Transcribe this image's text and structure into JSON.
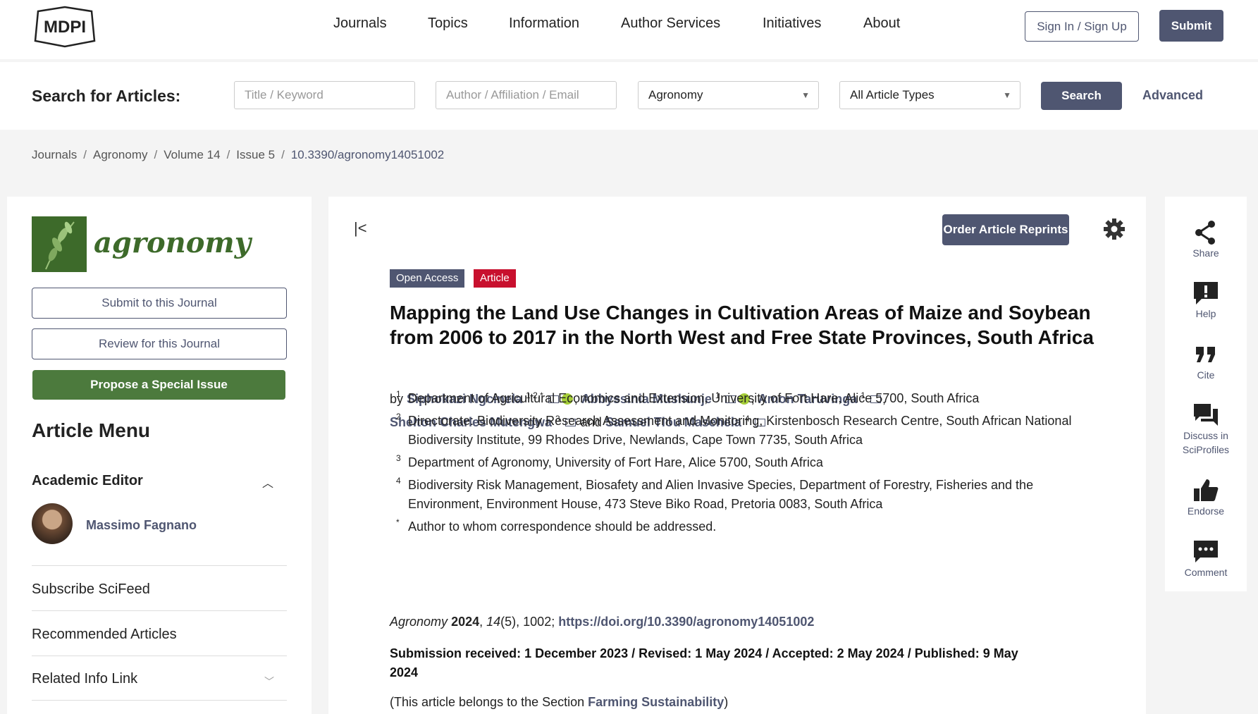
{
  "header": {
    "logo_text": "MDPI",
    "nav": [
      "Journals",
      "Topics",
      "Information",
      "Author Services",
      "Initiatives",
      "About"
    ],
    "signin_label": "Sign In / Sign Up",
    "submit_label": "Submit"
  },
  "search": {
    "label": "Search for Articles:",
    "title_placeholder": "Title / Keyword",
    "author_placeholder": "Author / Affiliation / Email",
    "journal_selected": "Agronomy",
    "type_selected": "All Article Types",
    "search_button": "Search",
    "advanced_label": "Advanced"
  },
  "breadcrumb": [
    "Journals",
    "Agronomy",
    "Volume 14",
    "Issue 5",
    "10.3390/agronomy14051002"
  ],
  "sidebar": {
    "journal_name": "agronomy",
    "submit_btn": "Submit to this Journal",
    "review_btn": "Review for this Journal",
    "propose_btn": "Propose a Special Issue",
    "menu_title": "Article Menu",
    "academic_editor_label": "Academic Editor",
    "editor_name": "Massimo Fagnano",
    "items": [
      "Subscribe SciFeed",
      "Recommended Articles",
      "Related Info Link"
    ]
  },
  "article": {
    "reprints_btn": "Order Article Reprints",
    "badge_open": "Open Access",
    "badge_type": "Article",
    "title": "Mapping the Land Use Changes in Cultivation Areas of Maize and Soybean from 2006 to 2017 in the North West and Free State Provinces, South Africa",
    "by": "by",
    "authors": [
      {
        "name": "Siphokazi Ngcinela",
        "sup": "1,2,*"
      },
      {
        "name": "Abbyssinia Mushunje",
        "sup": "1"
      },
      {
        "name": "Amon Taruvinga",
        "sup": "1"
      },
      {
        "name": "Shelton Charles Mutengwa",
        "sup": "3"
      },
      {
        "name": "Samuel Tlou Masehela",
        "sup": "4"
      }
    ],
    "and": "and",
    "affiliations": [
      {
        "mark": "1",
        "text": "Department of Agricultural Economics and Extension, University of Fort Hare, Alice 5700, South Africa"
      },
      {
        "mark": "2",
        "text": "Directorate: Biodiversity Research Assessment and Monitoring, Kirstenbosch Research Centre, South African National Biodiversity Institute, 99 Rhodes Drive, Newlands, Cape Town 7735, South Africa"
      },
      {
        "mark": "3",
        "text": "Department of Agronomy, University of Fort Hare, Alice 5700, South Africa"
      },
      {
        "mark": "4",
        "text": "Biodiversity Risk Management, Biosafety and Alien Invasive Species, Department of Forestry, Fisheries and the Environment, Environment House, 473 Steve Biko Road, Pretoria 0083, South Africa"
      },
      {
        "mark": "*",
        "text": "Author to whom correspondence should be addressed."
      }
    ],
    "cite_journal": "Agronomy",
    "cite_year": "2024",
    "cite_volume": "14",
    "cite_rest": "(5), 1002;",
    "doi": "https://doi.org/10.3390/agronomy14051002",
    "dates": "Submission received: 1 December 2023 / Revised: 1 May 2024 / Accepted: 2 May 2024 / Published: 9 May 2024",
    "section_prefix": "(This article belongs to the Section",
    "section_name": "Farming Sustainability",
    "section_suffix": ")"
  },
  "rail": {
    "share": "Share",
    "help": "Help",
    "cite": "Cite",
    "discuss": "Discuss in SciProfiles",
    "endorse": "Endorse",
    "comment": "Comment"
  },
  "colors": {
    "brand": "#4f5671",
    "journal_green": "#4c7a3d",
    "badge_red": "#c8102e",
    "orcid": "#a6ce39"
  }
}
